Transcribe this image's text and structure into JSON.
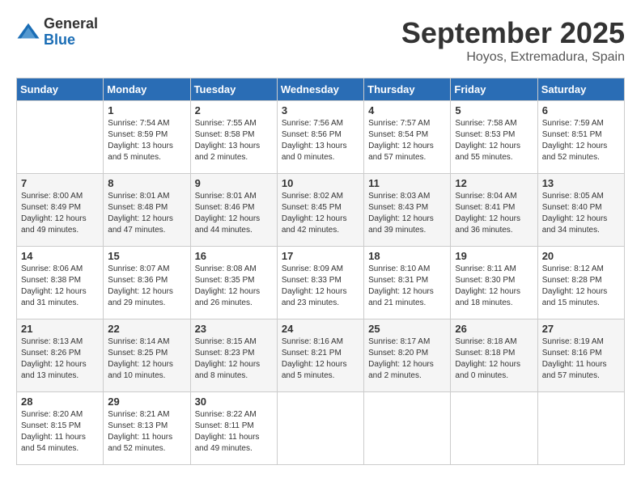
{
  "header": {
    "logo_general": "General",
    "logo_blue": "Blue",
    "month_title": "September 2025",
    "subtitle": "Hoyos, Extremadura, Spain"
  },
  "weekdays": [
    "Sunday",
    "Monday",
    "Tuesday",
    "Wednesday",
    "Thursday",
    "Friday",
    "Saturday"
  ],
  "weeks": [
    [
      {
        "day": "",
        "info": ""
      },
      {
        "day": "1",
        "info": "Sunrise: 7:54 AM\nSunset: 8:59 PM\nDaylight: 13 hours\nand 5 minutes."
      },
      {
        "day": "2",
        "info": "Sunrise: 7:55 AM\nSunset: 8:58 PM\nDaylight: 13 hours\nand 2 minutes."
      },
      {
        "day": "3",
        "info": "Sunrise: 7:56 AM\nSunset: 8:56 PM\nDaylight: 13 hours\nand 0 minutes."
      },
      {
        "day": "4",
        "info": "Sunrise: 7:57 AM\nSunset: 8:54 PM\nDaylight: 12 hours\nand 57 minutes."
      },
      {
        "day": "5",
        "info": "Sunrise: 7:58 AM\nSunset: 8:53 PM\nDaylight: 12 hours\nand 55 minutes."
      },
      {
        "day": "6",
        "info": "Sunrise: 7:59 AM\nSunset: 8:51 PM\nDaylight: 12 hours\nand 52 minutes."
      }
    ],
    [
      {
        "day": "7",
        "info": "Sunrise: 8:00 AM\nSunset: 8:49 PM\nDaylight: 12 hours\nand 49 minutes."
      },
      {
        "day": "8",
        "info": "Sunrise: 8:01 AM\nSunset: 8:48 PM\nDaylight: 12 hours\nand 47 minutes."
      },
      {
        "day": "9",
        "info": "Sunrise: 8:01 AM\nSunset: 8:46 PM\nDaylight: 12 hours\nand 44 minutes."
      },
      {
        "day": "10",
        "info": "Sunrise: 8:02 AM\nSunset: 8:45 PM\nDaylight: 12 hours\nand 42 minutes."
      },
      {
        "day": "11",
        "info": "Sunrise: 8:03 AM\nSunset: 8:43 PM\nDaylight: 12 hours\nand 39 minutes."
      },
      {
        "day": "12",
        "info": "Sunrise: 8:04 AM\nSunset: 8:41 PM\nDaylight: 12 hours\nand 36 minutes."
      },
      {
        "day": "13",
        "info": "Sunrise: 8:05 AM\nSunset: 8:40 PM\nDaylight: 12 hours\nand 34 minutes."
      }
    ],
    [
      {
        "day": "14",
        "info": "Sunrise: 8:06 AM\nSunset: 8:38 PM\nDaylight: 12 hours\nand 31 minutes."
      },
      {
        "day": "15",
        "info": "Sunrise: 8:07 AM\nSunset: 8:36 PM\nDaylight: 12 hours\nand 29 minutes."
      },
      {
        "day": "16",
        "info": "Sunrise: 8:08 AM\nSunset: 8:35 PM\nDaylight: 12 hours\nand 26 minutes."
      },
      {
        "day": "17",
        "info": "Sunrise: 8:09 AM\nSunset: 8:33 PM\nDaylight: 12 hours\nand 23 minutes."
      },
      {
        "day": "18",
        "info": "Sunrise: 8:10 AM\nSunset: 8:31 PM\nDaylight: 12 hours\nand 21 minutes."
      },
      {
        "day": "19",
        "info": "Sunrise: 8:11 AM\nSunset: 8:30 PM\nDaylight: 12 hours\nand 18 minutes."
      },
      {
        "day": "20",
        "info": "Sunrise: 8:12 AM\nSunset: 8:28 PM\nDaylight: 12 hours\nand 15 minutes."
      }
    ],
    [
      {
        "day": "21",
        "info": "Sunrise: 8:13 AM\nSunset: 8:26 PM\nDaylight: 12 hours\nand 13 minutes."
      },
      {
        "day": "22",
        "info": "Sunrise: 8:14 AM\nSunset: 8:25 PM\nDaylight: 12 hours\nand 10 minutes."
      },
      {
        "day": "23",
        "info": "Sunrise: 8:15 AM\nSunset: 8:23 PM\nDaylight: 12 hours\nand 8 minutes."
      },
      {
        "day": "24",
        "info": "Sunrise: 8:16 AM\nSunset: 8:21 PM\nDaylight: 12 hours\nand 5 minutes."
      },
      {
        "day": "25",
        "info": "Sunrise: 8:17 AM\nSunset: 8:20 PM\nDaylight: 12 hours\nand 2 minutes."
      },
      {
        "day": "26",
        "info": "Sunrise: 8:18 AM\nSunset: 8:18 PM\nDaylight: 12 hours\nand 0 minutes."
      },
      {
        "day": "27",
        "info": "Sunrise: 8:19 AM\nSunset: 8:16 PM\nDaylight: 11 hours\nand 57 minutes."
      }
    ],
    [
      {
        "day": "28",
        "info": "Sunrise: 8:20 AM\nSunset: 8:15 PM\nDaylight: 11 hours\nand 54 minutes."
      },
      {
        "day": "29",
        "info": "Sunrise: 8:21 AM\nSunset: 8:13 PM\nDaylight: 11 hours\nand 52 minutes."
      },
      {
        "day": "30",
        "info": "Sunrise: 8:22 AM\nSunset: 8:11 PM\nDaylight: 11 hours\nand 49 minutes."
      },
      {
        "day": "",
        "info": ""
      },
      {
        "day": "",
        "info": ""
      },
      {
        "day": "",
        "info": ""
      },
      {
        "day": "",
        "info": ""
      }
    ]
  ]
}
